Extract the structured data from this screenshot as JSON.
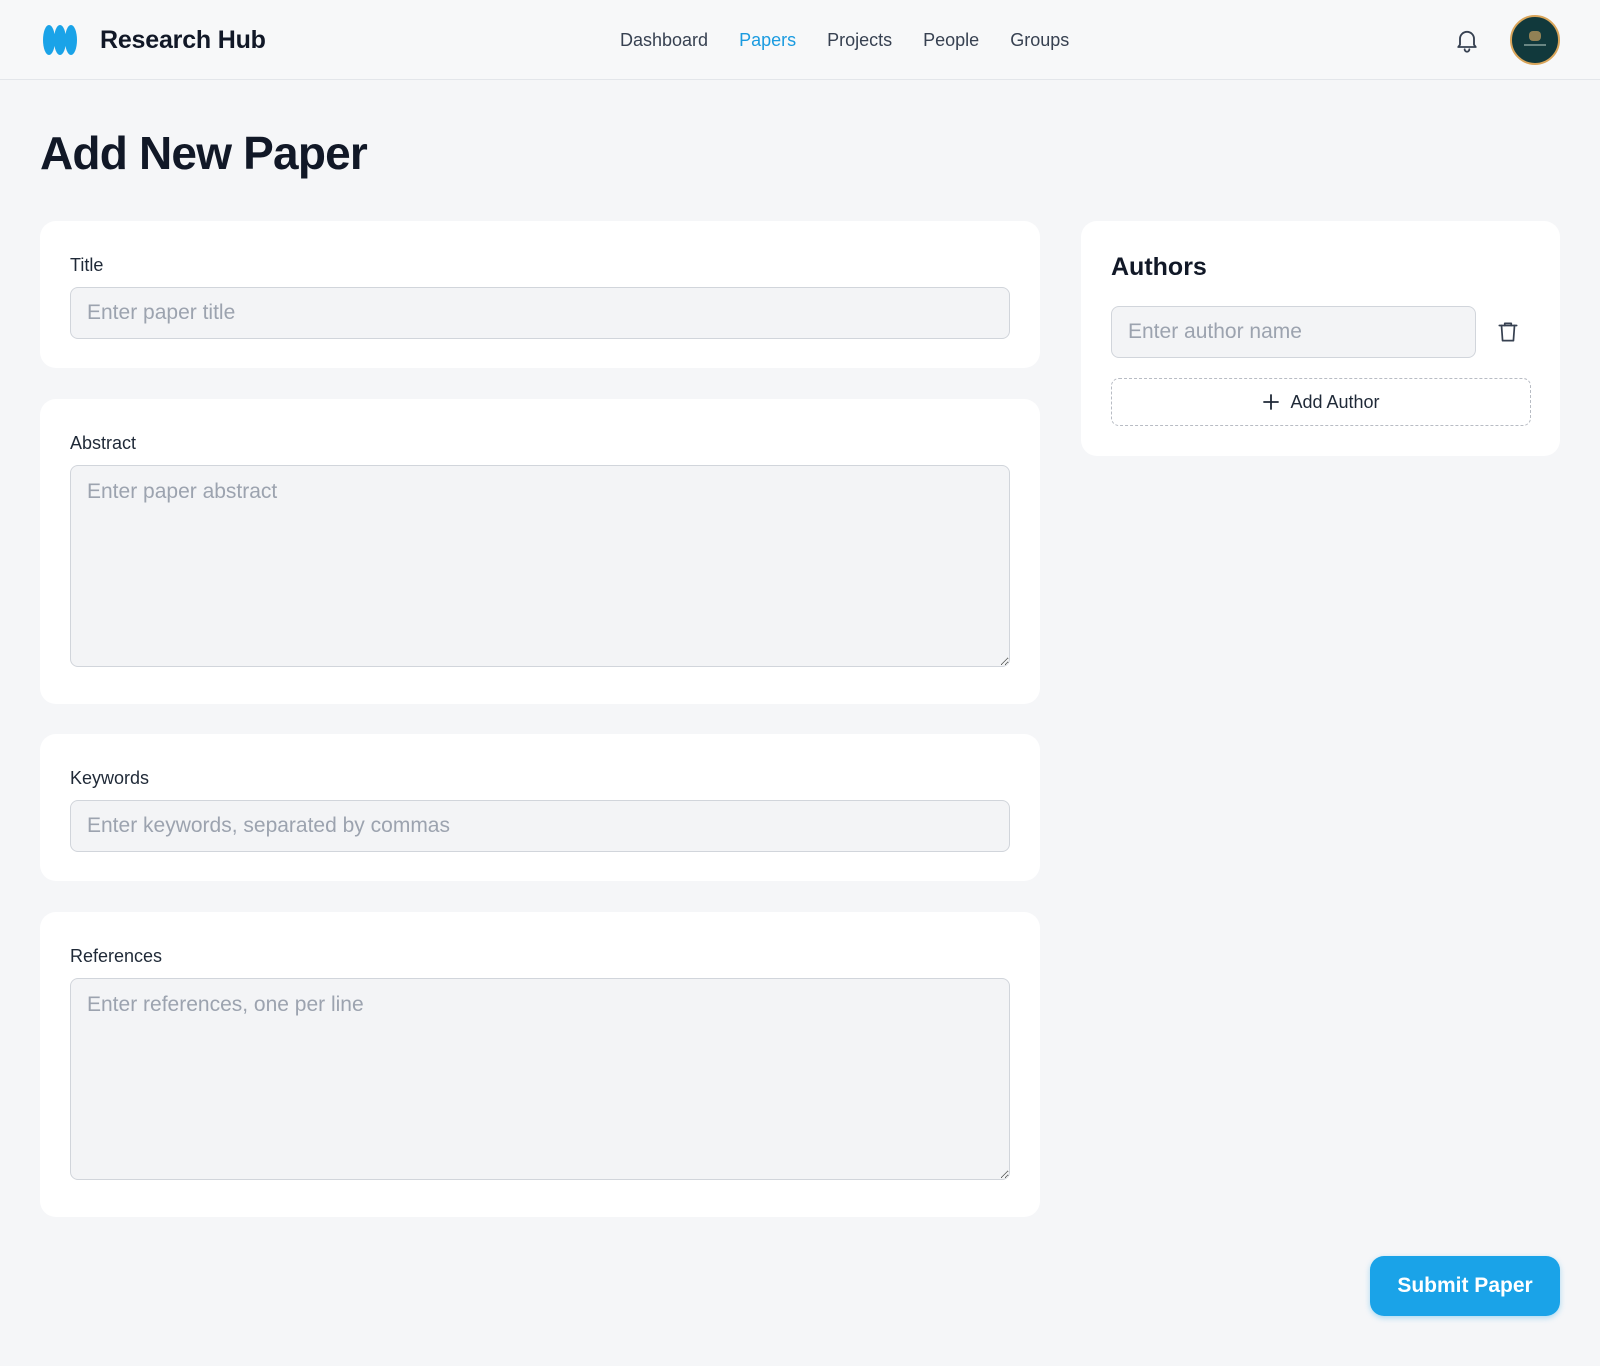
{
  "header": {
    "brand_name": "Research Hub",
    "logo_icon": "brand-logo-icon",
    "nav": [
      {
        "label": "Dashboard",
        "active": false
      },
      {
        "label": "Papers",
        "active": true
      },
      {
        "label": "Projects",
        "active": false
      },
      {
        "label": "People",
        "active": false
      },
      {
        "label": "Groups",
        "active": false
      }
    ],
    "notification_icon": "bell-icon",
    "avatar_icon": "user-avatar"
  },
  "page": {
    "title": "Add New Paper"
  },
  "form": {
    "title": {
      "label": "Title",
      "placeholder": "Enter paper title",
      "value": ""
    },
    "abstract": {
      "label": "Abstract",
      "placeholder": "Enter paper abstract",
      "value": ""
    },
    "keywords": {
      "label": "Keywords",
      "placeholder": "Enter keywords, separated by commas",
      "value": ""
    },
    "references": {
      "label": "References",
      "placeholder": "Enter references, one per line",
      "value": ""
    }
  },
  "authors": {
    "heading": "Authors",
    "input_placeholder": "Enter author name",
    "input_value": "",
    "delete_icon": "trash-icon",
    "add_button_label": "Add Author",
    "add_icon": "plus-icon"
  },
  "actions": {
    "submit_label": "Submit Paper"
  },
  "colors": {
    "accent": "#1aa3e8",
    "active_nav": "#1a9be0",
    "background": "#f5f6f8",
    "card": "#ffffff"
  }
}
